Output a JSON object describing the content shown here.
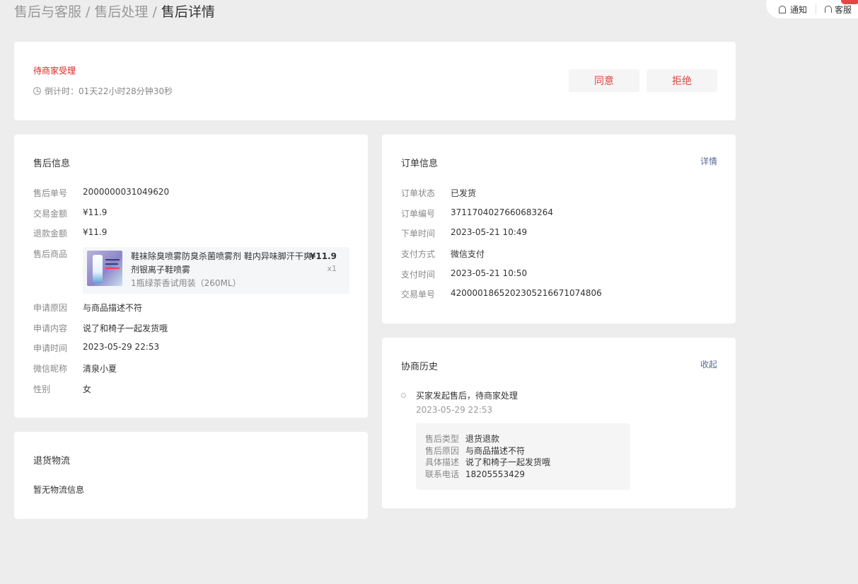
{
  "breadcrumb": {
    "level1": "售后与客服",
    "level2": "售后处理",
    "current": "售后详情",
    "separator": "/"
  },
  "top_bar": {
    "notify_label": "通知",
    "service_label": "客服"
  },
  "status": {
    "title": "待商家受理",
    "countdown": "倒计时：01天22小时28分钟30秒",
    "agree_label": "同意",
    "reject_label": "拒绝"
  },
  "aftersale": {
    "title": "售后信息",
    "order_no_label": "售后单号",
    "order_no": "2000000031049620",
    "trade_amount_label": "交易金额",
    "trade_amount": "¥11.9",
    "refund_amount_label": "退款金额",
    "refund_amount": "¥11.9",
    "product_label": "售后商品",
    "product": {
      "name": "鞋袜除臭喷雾防臭杀菌喷雾剂 鞋内异味脚汗干爽剂银离子鞋喷雾",
      "spec": "1瓶绿茶香试用装（260ML）",
      "price": "¥11.9",
      "qty": "x1"
    },
    "reason_label": "申请原因",
    "reason": "与商品描述不符",
    "content_label": "申请内容",
    "content": "说了和椅子一起发货哦",
    "apply_time_label": "申请时间",
    "apply_time": "2023-05-29 22:53",
    "wechat_label": "微信昵称",
    "wechat": "清泉小夏",
    "gender_label": "性别",
    "gender": "女"
  },
  "logistics": {
    "title": "退货物流",
    "empty": "暂无物流信息"
  },
  "order": {
    "title": "订单信息",
    "detail_link": "详情",
    "status_label": "订单状态",
    "status": "已发货",
    "order_no_label": "订单编号",
    "order_no": "3711704027660683264",
    "order_time_label": "下单时间",
    "order_time": "2023-05-21 10:49",
    "pay_method_label": "支付方式",
    "pay_method": "微信支付",
    "pay_time_label": "支付时间",
    "pay_time": "2023-05-21 10:50",
    "trade_no_label": "交易单号",
    "trade_no": "4200001865202305216671074806"
  },
  "history": {
    "title": "协商历史",
    "collapse_link": "收起",
    "event": "买家发起售后，待商家处理",
    "time": "2023-05-29 22:53",
    "details": [
      {
        "k": "售后类型",
        "v": "退货退款"
      },
      {
        "k": "售后原因",
        "v": "与商品描述不符"
      },
      {
        "k": "具体描述",
        "v": "说了和椅子一起发货哦"
      },
      {
        "k": "联系电话",
        "v": "18205553429"
      }
    ]
  },
  "colors": {
    "accent_red": "#e02020",
    "link_blue": "#576b95",
    "background": "#ededed"
  }
}
